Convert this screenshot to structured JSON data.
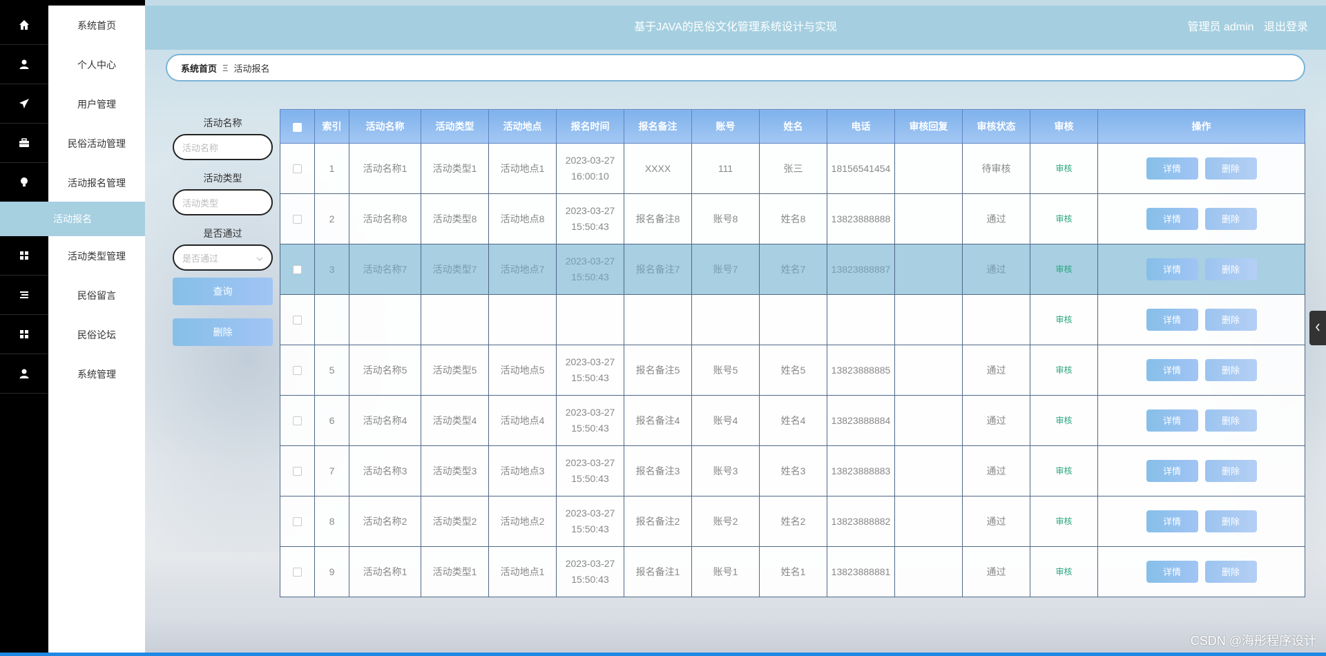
{
  "header": {
    "title": "基于JAVA的民俗文化管理系统设计与实现",
    "user": "管理员 admin",
    "logout": "退出登录"
  },
  "sidebar": {
    "items": [
      {
        "label": "系统首页",
        "icon": "home-icon"
      },
      {
        "label": "个人中心",
        "icon": "user-icon"
      },
      {
        "label": "用户管理",
        "icon": "send-icon"
      },
      {
        "label": "民俗活动管理",
        "icon": "briefcase-icon"
      },
      {
        "label": "活动报名管理",
        "icon": "lightbulb-icon"
      },
      {
        "label": "活动类型管理",
        "icon": "grid-icon"
      },
      {
        "label": "民俗留言",
        "icon": "list-icon"
      },
      {
        "label": "民俗论坛",
        "icon": "grid-icon"
      },
      {
        "label": "系统管理",
        "icon": "user-icon"
      }
    ],
    "active_sub": "活动报名"
  },
  "breadcrumb": {
    "home": "系统首页",
    "current": "活动报名"
  },
  "search": {
    "name_label": "活动名称",
    "name_placeholder": "活动名称",
    "type_label": "活动类型",
    "type_placeholder": "活动类型",
    "status_label": "是否通过",
    "status_placeholder": "是否通过",
    "query_button": "查询",
    "delete_button": "删除"
  },
  "table": {
    "headers": [
      "索引",
      "活动名称",
      "活动类型",
      "活动地点",
      "报名时间",
      "报名备注",
      "账号",
      "姓名",
      "电话",
      "审核回复",
      "审核状态",
      "审核",
      "操作"
    ],
    "audit_label": "审核",
    "detail_label": "详情",
    "delete_label": "删除",
    "rows": [
      {
        "index": "1",
        "name": "活动名称1",
        "type": "活动类型1",
        "place": "活动地点1",
        "time": "2023-03-27 16:00:10",
        "note": "XXXX",
        "account": "111",
        "person": "张三",
        "phone": "18156541454",
        "reply": "",
        "status": "待审核"
      },
      {
        "index": "2",
        "name": "活动名称8",
        "type": "活动类型8",
        "place": "活动地点8",
        "time": "2023-03-27 15:50:43",
        "note": "报名备注8",
        "account": "账号8",
        "person": "姓名8",
        "phone": "13823888888",
        "reply": "",
        "status": "通过"
      },
      {
        "index": "3",
        "name": "活动名称7",
        "type": "活动类型7",
        "place": "活动地点7",
        "time": "2023-03-27 15:50:43",
        "note": "报名备注7",
        "account": "账号7",
        "person": "姓名7",
        "phone": "13823888887",
        "reply": "",
        "status": "通过"
      },
      {
        "index": "",
        "name": "",
        "type": "",
        "place": "",
        "time": "",
        "note": "",
        "account": "",
        "person": "",
        "phone": "",
        "reply": "",
        "status": ""
      },
      {
        "index": "5",
        "name": "活动名称5",
        "type": "活动类型5",
        "place": "活动地点5",
        "time": "2023-03-27 15:50:43",
        "note": "报名备注5",
        "account": "账号5",
        "person": "姓名5",
        "phone": "13823888885",
        "reply": "",
        "status": "通过"
      },
      {
        "index": "6",
        "name": "活动名称4",
        "type": "活动类型4",
        "place": "活动地点4",
        "time": "2023-03-27 15:50:43",
        "note": "报名备注4",
        "account": "账号4",
        "person": "姓名4",
        "phone": "13823888884",
        "reply": "",
        "status": "通过"
      },
      {
        "index": "7",
        "name": "活动名称3",
        "type": "活动类型3",
        "place": "活动地点3",
        "time": "2023-03-27 15:50:43",
        "note": "报名备注3",
        "account": "账号3",
        "person": "姓名3",
        "phone": "13823888883",
        "reply": "",
        "status": "通过"
      },
      {
        "index": "8",
        "name": "活动名称2",
        "type": "活动类型2",
        "place": "活动地点2",
        "time": "2023-03-27 15:50:43",
        "note": "报名备注2",
        "account": "账号2",
        "person": "姓名2",
        "phone": "13823888882",
        "reply": "",
        "status": "通过"
      },
      {
        "index": "9",
        "name": "活动名称1",
        "type": "活动类型1",
        "place": "活动地点1",
        "time": "2023-03-27 15:50:43",
        "note": "报名备注1",
        "account": "账号1",
        "person": "姓名1",
        "phone": "13823888881",
        "reply": "",
        "status": "通过"
      }
    ]
  },
  "watermark": "CSDN @海彤程序设计"
}
